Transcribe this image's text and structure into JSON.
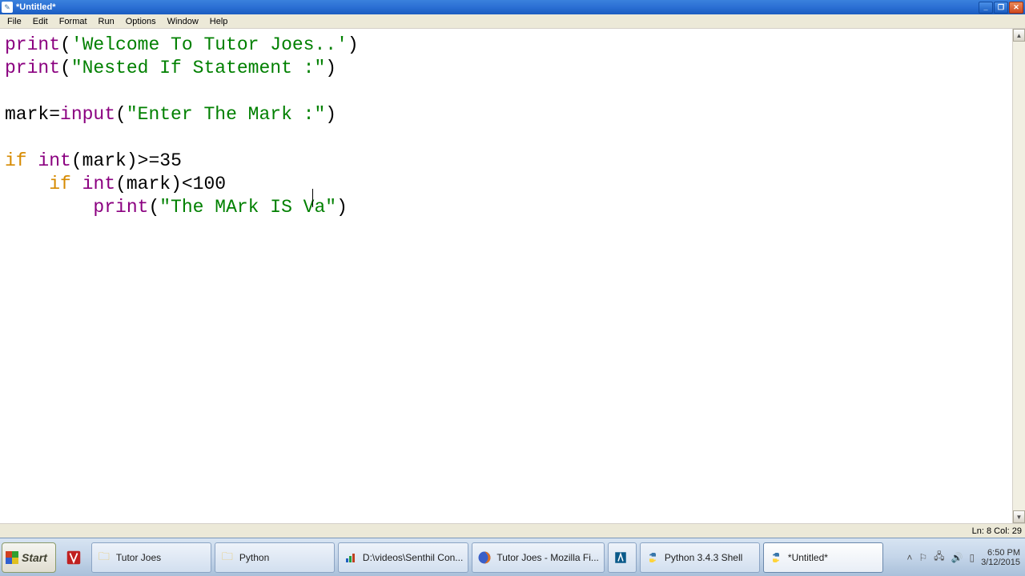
{
  "window": {
    "title": "*Untitled*"
  },
  "menus": [
    "File",
    "Edit",
    "Format",
    "Run",
    "Options",
    "Window",
    "Help"
  ],
  "code": {
    "l1_kw": "print",
    "l1_p1": "(",
    "l1_str": "'Welcome To Tutor Joes..'",
    "l1_p2": ")",
    "l2_kw": "print",
    "l2_p1": "(",
    "l2_str": "\"Nested If Statement :\"",
    "l2_p2": ")",
    "l4_a": "mark=",
    "l4_kw": "input",
    "l4_p1": "(",
    "l4_str": "\"Enter The Mark :\"",
    "l4_p2": ")",
    "l6_if": "if",
    "l6_sp": " ",
    "l6_int": "int",
    "l6_p1": "(mark)>=35",
    "l7_sp": "    ",
    "l7_if": "if",
    "l7_sp2": " ",
    "l7_int": "int",
    "l7_rest": "(mark)<100",
    "l8_sp": "        ",
    "l8_kw": "print",
    "l8_p1": "(",
    "l8_str": "\"The MArk IS Va\"",
    "l8_p2": ")"
  },
  "status": "Ln: 8 Col: 29",
  "taskbar": {
    "start": "Start",
    "tasks": [
      {
        "label": "Tutor Joes",
        "icon": "folder"
      },
      {
        "label": "Python",
        "icon": "folder"
      },
      {
        "label": "D:\\videos\\Senthil Con...",
        "icon": "chart"
      },
      {
        "label": "Tutor Joes - Mozilla Fi...",
        "icon": "firefox"
      },
      {
        "label": "",
        "icon": "adobe"
      },
      {
        "label": "Python 3.4.3 Shell",
        "icon": "python"
      },
      {
        "label": "*Untitled*",
        "icon": "python",
        "active": true
      }
    ],
    "time": "6:50 PM",
    "date": "3/12/2015"
  }
}
